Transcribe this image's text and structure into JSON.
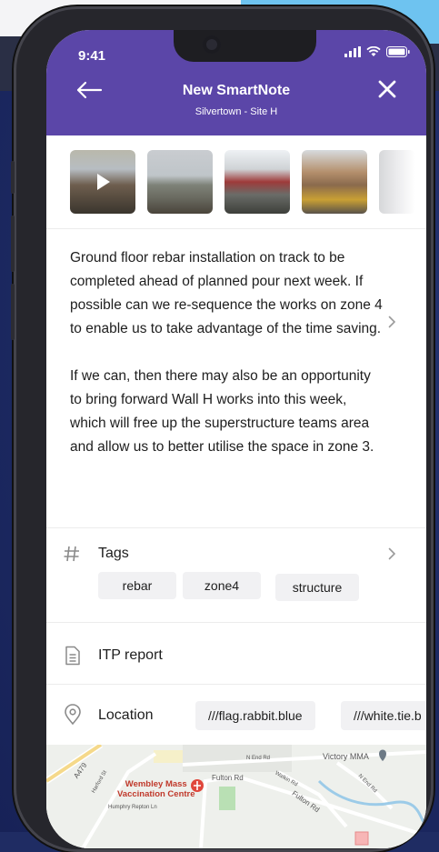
{
  "status_bar": {
    "time": "9:41"
  },
  "header": {
    "title": "New SmartNote",
    "subtitle": "Silvertown - Site H",
    "back_icon": "arrow-left-icon",
    "close_icon": "close-icon"
  },
  "media": {
    "thumbnails": [
      {
        "type": "video"
      },
      {
        "type": "image"
      },
      {
        "type": "image"
      },
      {
        "type": "image"
      },
      {
        "type": "image"
      }
    ]
  },
  "note": {
    "paragraph1": "Ground floor rebar installation on track to be completed ahead of planned pour next week. If possible can we re-sequence the works on zone 4 to enable us to take advantage of the time saving.",
    "paragraph2": "If we can, then there may also be an opportunity to bring forward Wall H works into this week, which will free up the superstructure teams area and allow us to better utilise the space in zone 3."
  },
  "tags": {
    "label": "Tags",
    "items": [
      "rebar",
      "zone4",
      "structure"
    ]
  },
  "itp": {
    "label": "ITP report"
  },
  "location": {
    "label": "Location",
    "chips": [
      "///flag.rabbit.blue",
      "///white.tie.b"
    ]
  },
  "map": {
    "labels": {
      "victory": "Victory MMA",
      "wembley": "Wembley Mass\nVaccination Centre",
      "fulton": "Fulton Rd",
      "fulton2": "Fulton Rd",
      "nend": "N End Rd",
      "nend2": "N End Rd",
      "a479": "A479",
      "humphry": "Humphry Repton Ln",
      "watkin": "Watkin Rd",
      "harford": "Harford St"
    }
  },
  "colors": {
    "header": "#5b46a8",
    "background": "#1f2c63",
    "chip": "#f1f1f3"
  }
}
